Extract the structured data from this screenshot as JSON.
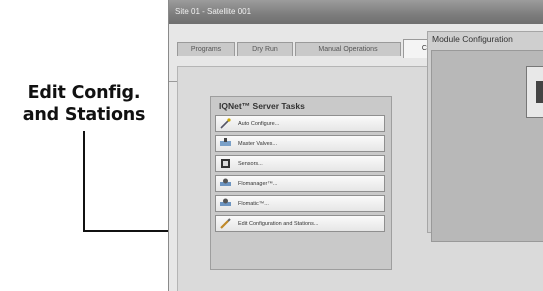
{
  "callout": {
    "line1": "Edit Config.",
    "line2": "and Stations"
  },
  "window": {
    "title": "Site 01 - Satellite 001"
  },
  "tabs": [
    {
      "label": "Programs"
    },
    {
      "label": "Dry Run"
    },
    {
      "label": "Manual Operations"
    },
    {
      "label": "Configure"
    }
  ],
  "active_tab": "Configure",
  "server_tasks": {
    "title": "IQNet™ Server Tasks",
    "items": [
      {
        "label": "Auto Configure...",
        "icon": "auto-configure-icon"
      },
      {
        "label": "Master Valves...",
        "icon": "master-valve-icon"
      },
      {
        "label": "Sensors...",
        "icon": "sensor-icon"
      },
      {
        "label": "Flomanager™...",
        "icon": "flomanager-icon"
      },
      {
        "label": "Flomatic™...",
        "icon": "flomatic-icon"
      },
      {
        "label": "Edit Configuration and Stations...",
        "icon": "edit-pencil-icon"
      }
    ]
  },
  "module_config": {
    "title": "Module Configuration"
  }
}
